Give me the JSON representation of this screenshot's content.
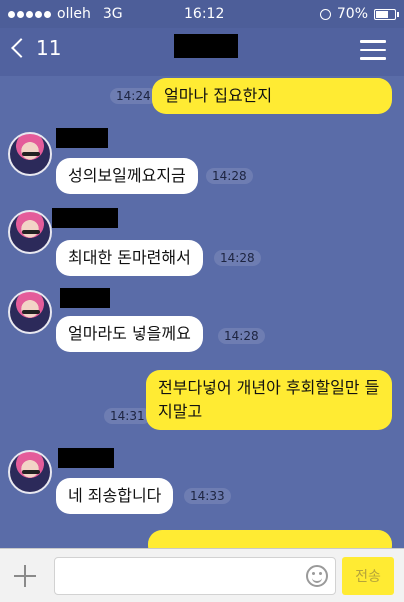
{
  "status_bar": {
    "carrier": "olleh",
    "network": "3G",
    "time": "16:12",
    "battery": "70%",
    "battery_level": 0.7
  },
  "header": {
    "back_count": "11",
    "title_redacted": true
  },
  "messages": [
    {
      "direction": "out",
      "text": "얼마나 집요한지",
      "time": "14:24"
    },
    {
      "direction": "in",
      "text": "성의보일께요지금",
      "time": "14:28"
    },
    {
      "direction": "in",
      "text": "최대한 돈마련해서",
      "time": "14:28"
    },
    {
      "direction": "in",
      "text": "얼마라도 넣을께요",
      "time": "14:28"
    },
    {
      "direction": "out",
      "text": "전부다넣어 개년아 후회할일만 들지말고",
      "time": "14:31"
    },
    {
      "direction": "in",
      "text": "네 죄송합니다",
      "time": "14:33"
    }
  ],
  "input_bar": {
    "placeholder": "",
    "send_label": "전송"
  },
  "colors": {
    "background": "#5a6ca8",
    "outgoing_bubble": "#ffeb33",
    "incoming_bubble": "#ffffff"
  }
}
